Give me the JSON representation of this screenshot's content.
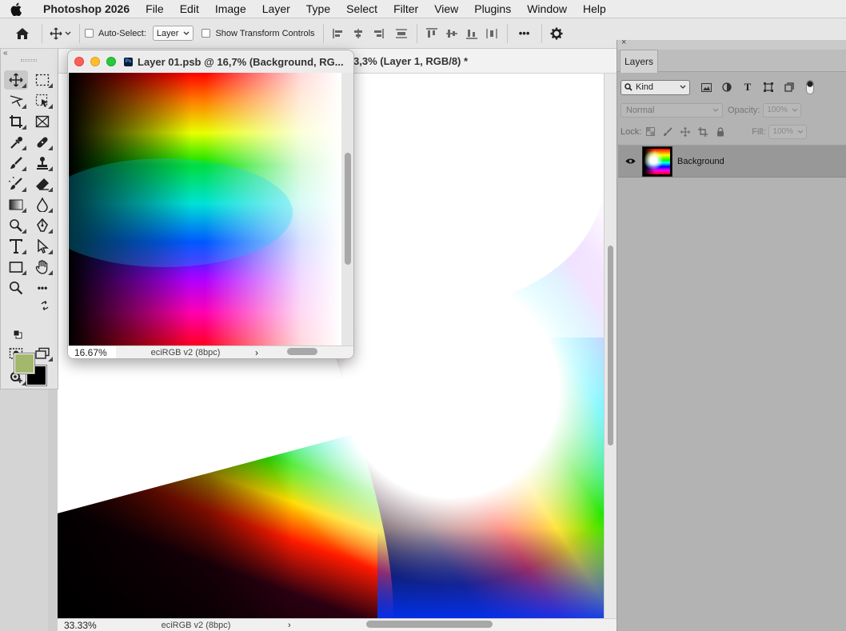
{
  "menubar": {
    "app_name": "Photoshop 2026",
    "items": [
      "File",
      "Edit",
      "Image",
      "Layer",
      "Type",
      "Select",
      "Filter",
      "View",
      "Plugins",
      "Window",
      "Help"
    ]
  },
  "options_bar": {
    "auto_select_label": "Auto-Select:",
    "auto_select_value": "Layer",
    "show_transform_label": "Show Transform Controls",
    "more_label": "•••"
  },
  "tools": {
    "more_label": "•••",
    "foreground_color": "#a3b86c",
    "background_color": "#000000"
  },
  "main_document": {
    "title_fragment": "3,3% (Layer 1, RGB/8) *",
    "zoom": "33.33%",
    "profile": "eciRGB v2 (8bpc)",
    "arrow": "›"
  },
  "floating_document": {
    "title": "Layer 01.psb @ 16,7% (Background, RG...",
    "zoom": "16.67%",
    "profile": "eciRGB v2 (8bpc)",
    "arrow": "›",
    "ps_badge": "Ps"
  },
  "layers_panel": {
    "tab_label": "Layers",
    "filter_kind": "Kind",
    "blend_mode": "Normal",
    "opacity_label": "Opacity:",
    "opacity_value": "100%",
    "lock_label": "Lock:",
    "fill_label": "Fill:",
    "fill_value": "100%",
    "layers": [
      {
        "name": "Background",
        "visible": true
      }
    ]
  }
}
